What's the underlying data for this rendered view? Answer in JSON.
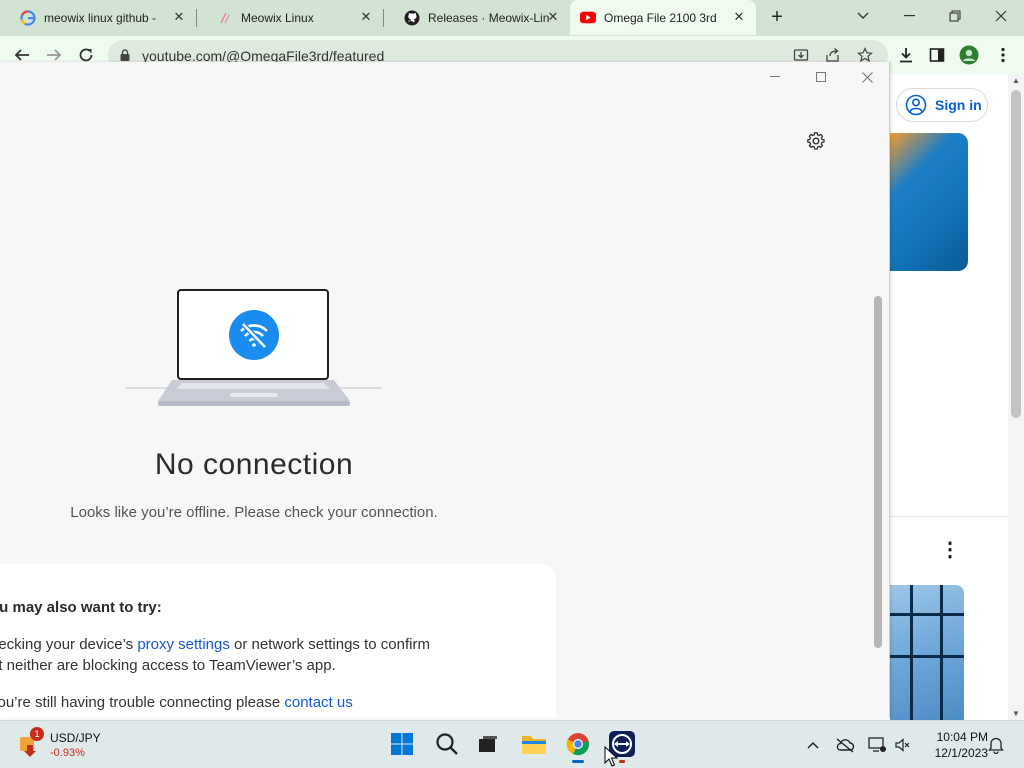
{
  "browser": {
    "tabs": [
      {
        "title": "meowix linux github -",
        "favicon": "google-icon"
      },
      {
        "title": "Meowix Linux",
        "favicon": "meowix-icon"
      },
      {
        "title": "Releases · Meowix-Lin",
        "favicon": "github-icon"
      },
      {
        "title": "Omega File 2100 3rd",
        "favicon": "youtube-icon",
        "active": true
      }
    ],
    "url": "youtube.com/@OmegaFile3rd/featured"
  },
  "youtube": {
    "sign_in_label": "Sign in",
    "accent_color": "#065fd4"
  },
  "teamviewer": {
    "heading": "No connection",
    "subtitle": "Looks like you’re offline. Please check your connection.",
    "try_heading": "ou may also want to try:",
    "try_line1_prefix": "hecking your device’s ",
    "try_line1_link": "proxy settings",
    "try_line1_suffix": " or network settings to confirm",
    "try_line2": "at neither are blocking access to TeamViewer’s app.",
    "try_line3_prefix": "you’re still having trouble connecting please ",
    "try_line3_link": "contact us",
    "wifi_color": "#1a8cf0"
  },
  "taskbar": {
    "ticker_label": "USD/JPY",
    "ticker_change": "-0.93%",
    "ticker_badge": "1",
    "time": "10:04 PM",
    "date": "12/1/2023"
  }
}
